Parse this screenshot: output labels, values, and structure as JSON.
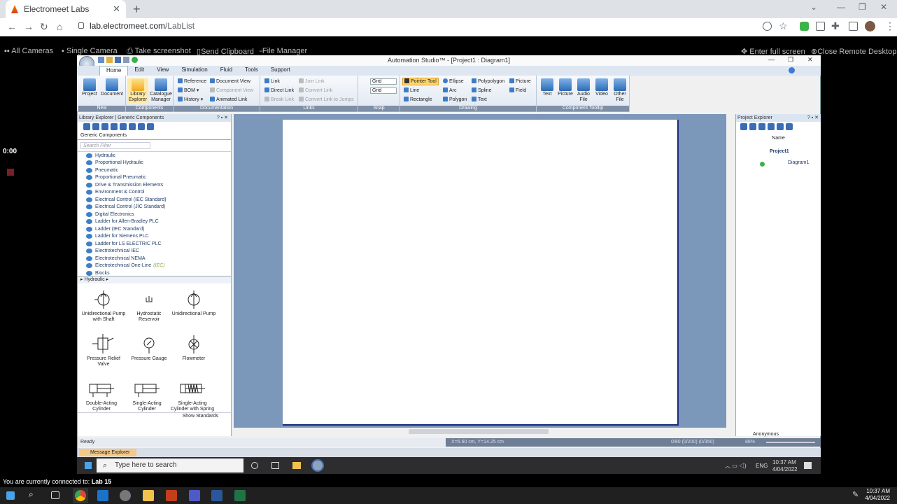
{
  "browser": {
    "tab_title": "Electromeet Labs",
    "url_host": "lab.electromeet.com",
    "url_path": "/LabList"
  },
  "remote_bar": {
    "all_cameras": "All Cameras",
    "single_camera": "Single Camera",
    "take_screenshot": "Take screenshot",
    "send_clipboard": "Send Clipboard",
    "file_manager": "File Manager",
    "enter_full_screen": "Enter full screen",
    "close_remote": "Close Remote Desktop"
  },
  "session": {
    "timer": "0:00",
    "connected_prefix": "You are currently connected to:",
    "lab_name": "Lab 15"
  },
  "app": {
    "title": "Automation Studio™ - [Project1 : Diagram1]",
    "menu_tabs": [
      "Home",
      "Edit",
      "View",
      "Simulation",
      "Fluid",
      "Tools",
      "Support"
    ],
    "ribbon": {
      "new": {
        "label": "New",
        "project": "Project",
        "document": "Document"
      },
      "components": {
        "label": "Components",
        "library": "Library Explorer",
        "catalogue": "Catalogue Manager"
      },
      "documentation": {
        "label": "Documentation",
        "reference": "Reference",
        "bom": "BOM",
        "history": "History",
        "document_view": "Document View",
        "component_view": "Component View",
        "animated_link": "Animated Link"
      },
      "links": {
        "label": "Links",
        "link": "Link",
        "direct_link": "Direct Link",
        "break_link": "Break Link",
        "join_link": "Join Link",
        "convert_link": "Convert Link",
        "convert_link_jumps": "Convert Link to Jumps"
      },
      "snap": {
        "label": "Snap",
        "grid1": "Grid",
        "grid2": "Grid"
      },
      "drawing": {
        "label": "Drawing",
        "pointer": "Pointer Tool",
        "line": "Line",
        "rectangle": "Rectangle",
        "ellipse": "Ellipse",
        "arc": "Arc",
        "polygon": "Polygon",
        "polypolygon": "Polypolygon",
        "spline": "Spline",
        "text": "Text",
        "picture": "Picture",
        "field": "Field"
      },
      "tooltip": {
        "label": "Component Tooltip",
        "text": "Text",
        "picture": "Picture",
        "audio": "Audio File",
        "video": "Video",
        "other": "Other File"
      }
    },
    "library": {
      "header": "Library Explorer | Generic Components",
      "tab": "Generic Components",
      "search_placeholder": "Search Filter",
      "tree": [
        "Hydraulic",
        "Proportional Hydraulic",
        "Pneumatic",
        "Proportional Pneumatic",
        "Drive & Transmission Elements",
        "Environment & Control",
        "Electrical Control (IEC Standard)",
        "Electrical Control (JIC Standard)",
        "Digital Electronics",
        "Ladder for Allen-Bradley PLC",
        "Ladder (IEC Standard)",
        "Ladder for Siemens PLC",
        "Ladder for LS ELECTRIC PLC",
        "Electrotechnical IEC",
        "Electrotechnical NEMA",
        "Electrotechnical One-Line",
        "Blocks"
      ],
      "tree_suffix": "(IEC)",
      "crumb": "Hydraulic",
      "symbols": [
        "Unidirectional Pump with Shaft",
        "Hydrostatic Reservoir",
        "Unidirectional Pump",
        "Pressure Relief Valve",
        "Pressure Gauge",
        "Flowmeter",
        "Double-Acting Cylinder",
        "Single-Acting Cylinder",
        "Single-Acting Cylinder with Spring"
      ],
      "show_standards": "Show Standards"
    },
    "project": {
      "header": "Project Explorer",
      "name_col": "Name",
      "project": "Project1",
      "diagram": "Diagram1",
      "user": "Anonymous"
    },
    "status": {
      "ready": "Ready",
      "coords": "X=6.60 cm, Y=14.25 cm",
      "count": "0/80 (0/200) (0/350)",
      "zoom": "88%"
    },
    "message_explorer": "Message Explorer"
  },
  "inner_taskbar": {
    "search_placeholder": "Type here to search",
    "lang": "ENG",
    "time": "10:37 AM",
    "date": "4/04/2022"
  },
  "outer_taskbar": {
    "time": "10:37 AM",
    "date": "4/04/2022"
  }
}
